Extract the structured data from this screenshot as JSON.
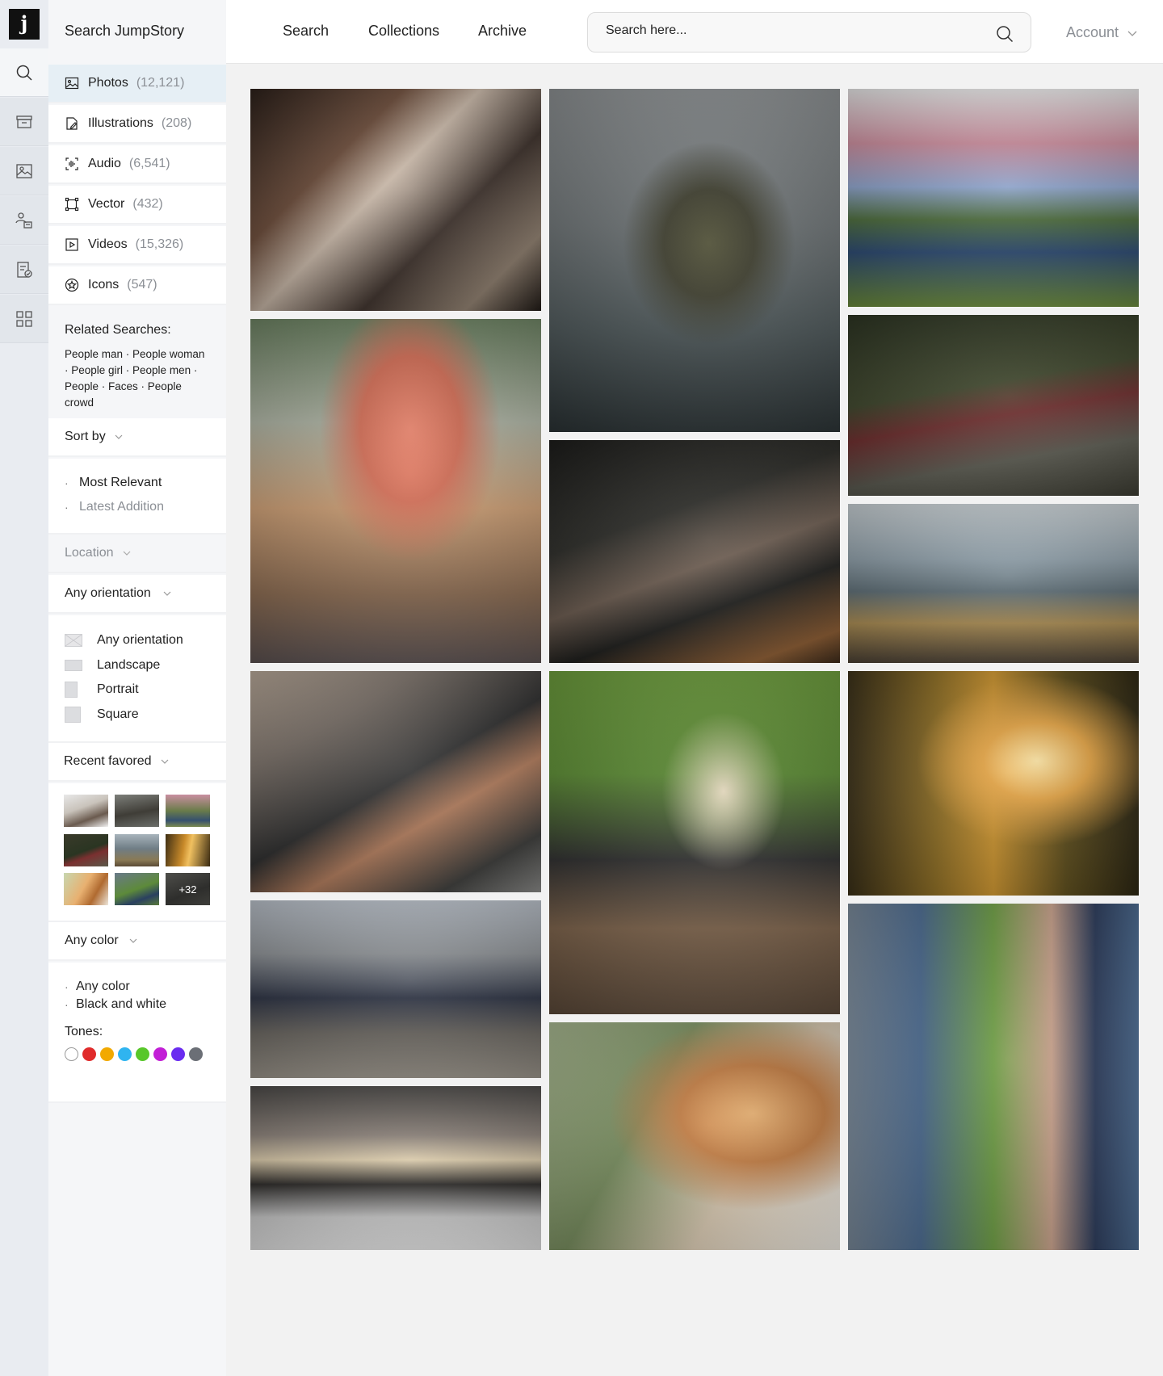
{
  "logo": {
    "letter": "j"
  },
  "sidebar": {
    "title": "Search JumpStory",
    "categories": [
      {
        "label": "Photos",
        "count": "(12,121)",
        "icon": "photo-icon"
      },
      {
        "label": "Illustrations",
        "count": "(208)",
        "icon": "illustration-icon"
      },
      {
        "label": "Audio",
        "count": "(6,541)",
        "icon": "audio-icon"
      },
      {
        "label": "Vector",
        "count": "(432)",
        "icon": "vector-icon"
      },
      {
        "label": "Videos",
        "count": "(15,326)",
        "icon": "video-icon"
      },
      {
        "label": "Icons",
        "count": "(547)",
        "icon": "icons-icon"
      }
    ],
    "related": {
      "heading": "Related Searches:",
      "links": "People man · People woman · People girl · People men · People · Faces · People crowd"
    },
    "sort": {
      "label": "Sort by",
      "options": [
        "Most Relevant",
        "Latest Addition"
      ]
    },
    "location": {
      "label": "Location"
    },
    "orientation": {
      "label": "Any orientation",
      "options": [
        "Any orientation",
        "Landscape",
        "Portrait",
        "Square"
      ]
    },
    "favored": {
      "label": "Recent favored",
      "more": "+32"
    },
    "color": {
      "label": "Any color",
      "options": [
        "Any color",
        "Black and white"
      ],
      "tones_heading": "Tones:",
      "tones": [
        "#ffffff",
        "#e02b2b",
        "#f2a900",
        "#2fb4f0",
        "#58c72a",
        "#c21fd6",
        "#6a2cf0",
        "#6b6f76"
      ]
    }
  },
  "topbar": {
    "nav": [
      "Search",
      "Collections",
      "Archive"
    ],
    "search_placeholder": "Search here...",
    "account": "Account"
  }
}
